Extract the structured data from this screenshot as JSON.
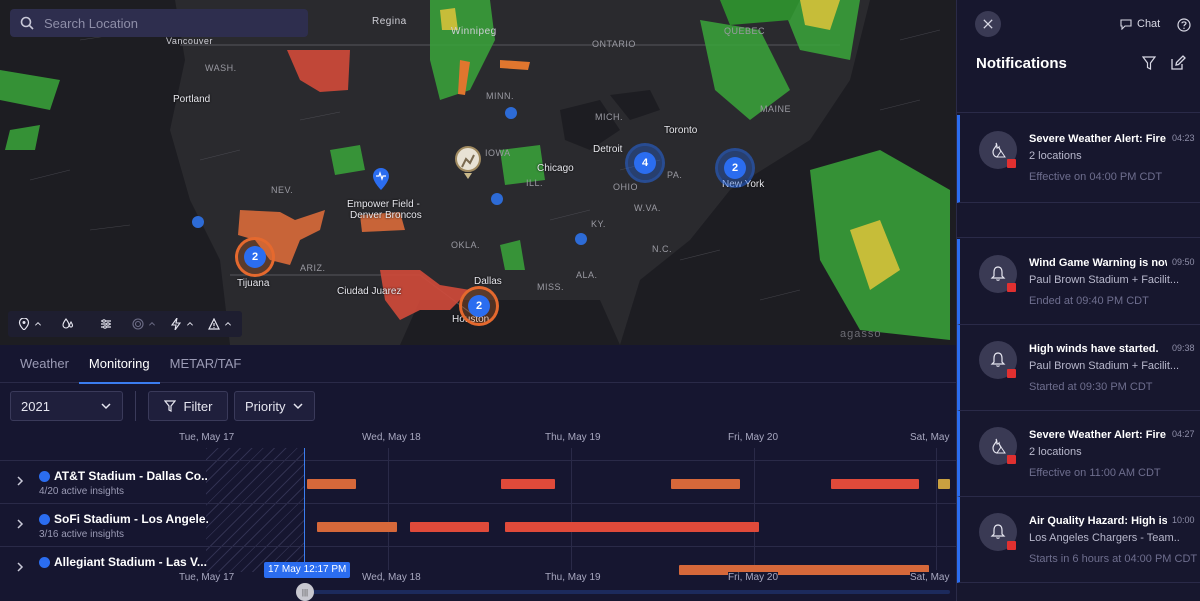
{
  "map": {
    "search_placeholder": "Search Location",
    "watermark": "agasso",
    "region_labels": [
      {
        "text": "Regina"
      },
      {
        "text": "Winnipeg"
      },
      {
        "text": "Vancouver"
      },
      {
        "text": "WASH."
      },
      {
        "text": "QUEBEC"
      },
      {
        "text": "ONTARIO"
      },
      {
        "text": "MINN."
      },
      {
        "text": "MICH."
      },
      {
        "text": "MAINE"
      },
      {
        "text": "NEV."
      },
      {
        "text": "ARIZ."
      },
      {
        "text": "OKLA."
      },
      {
        "text": "MISS."
      },
      {
        "text": "ALA."
      },
      {
        "text": "W.VA."
      },
      {
        "text": "N.C."
      },
      {
        "text": "PA."
      },
      {
        "text": "OHIO"
      },
      {
        "text": "ILL."
      },
      {
        "text": "KY."
      },
      {
        "text": "IOWA"
      }
    ],
    "cities": [
      {
        "text": "Portland"
      },
      {
        "text": "Detroit"
      },
      {
        "text": "Toronto"
      },
      {
        "text": "Chicago"
      },
      {
        "text": "New York"
      },
      {
        "text": "Dallas"
      },
      {
        "text": "Houston"
      },
      {
        "text": "Tijuana"
      },
      {
        "text": "Ciudad Juarez"
      },
      {
        "text": "Empower Field -"
      },
      {
        "text": "Denver Broncos"
      }
    ],
    "clusters": [
      {
        "count": "2",
        "style": "orange"
      },
      {
        "count": "2",
        "style": "orange"
      },
      {
        "count": "4",
        "style": "blue"
      },
      {
        "count": "2",
        "style": "blue"
      }
    ],
    "toolbar": [
      "location-pin-icon",
      "drops-icon",
      "sliders-icon",
      "radar-icon",
      "lightning-icon",
      "warning-icon"
    ]
  },
  "tabs": [
    {
      "label": "Weather",
      "active": false
    },
    {
      "label": "Monitoring",
      "active": true
    },
    {
      "label": "METAR/TAF",
      "active": false
    }
  ],
  "controls": {
    "year": "2021",
    "filter_label": "Filter",
    "priority_label": "Priority"
  },
  "timeline": {
    "days": [
      "Tue, May 17",
      "Wed, May 18",
      "Thu, May 19",
      "Fri, May 20",
      "Sat, May"
    ],
    "now_label": "17 May 12:17 PM",
    "rows": [
      {
        "name": "AT&T Stadium - Dallas Co...",
        "sub": "4/20 active insights"
      },
      {
        "name": "SoFi Stadium - Los Angele...",
        "sub": "3/16 active insights"
      },
      {
        "name": "Allegiant Stadium - Las V...",
        "sub": ""
      }
    ]
  },
  "notifications": {
    "title": "Notifications",
    "chat_label": "Chat",
    "items": [
      {
        "icon": "fire-warning-icon",
        "title": "Severe Weather Alert: Fire ...",
        "time": "04:23",
        "sub": "2 locations",
        "meta": "Effective on 04:00 PM CDT"
      },
      {
        "icon": "bell-icon",
        "title": "Wind Game Warning is now...",
        "time": "09:50",
        "sub": "Paul Brown Stadium + Facilit...",
        "meta": "Ended at 09:40 PM CDT"
      },
      {
        "icon": "bell-icon",
        "title": "High winds have started.",
        "time": "09:38",
        "sub": "Paul Brown Stadium + Facilit...",
        "meta": "Started at 09:30 PM CDT"
      },
      {
        "icon": "fire-warning-icon",
        "title": "Severe Weather Alert: Fire ...",
        "time": "04:27",
        "sub": "2 locations",
        "meta": "Effective on 11:00 AM CDT"
      },
      {
        "icon": "bell-icon",
        "title": "Air Quality Hazard: High is s...",
        "time": "10:00",
        "sub": "Los Angeles Chargers - Team...",
        "meta": "Starts in 6 hours at 04:00 PM CDT"
      }
    ]
  },
  "colors": {
    "accent": "#2b6df0",
    "alert_red": "#e03030",
    "bar_orange": "#d6683a",
    "bar_red": "#e04a3a"
  }
}
